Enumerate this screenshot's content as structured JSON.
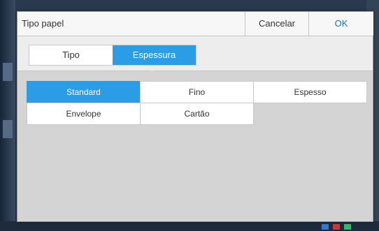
{
  "dialog": {
    "title": "Tipo papel",
    "cancel_label": "Cancelar",
    "ok_label": "OK"
  },
  "tabs": [
    {
      "label": "Tipo",
      "active": false
    },
    {
      "label": "Espessura",
      "active": true
    }
  ],
  "options": [
    {
      "label": "Standard",
      "selected": true
    },
    {
      "label": "Fino",
      "selected": false
    },
    {
      "label": "Espesso",
      "selected": false
    },
    {
      "label": "Envelope",
      "selected": false
    },
    {
      "label": "Cartão",
      "selected": false
    }
  ],
  "colors": {
    "accent": "#2a9de6",
    "ok_text": "#1f6fb5"
  }
}
